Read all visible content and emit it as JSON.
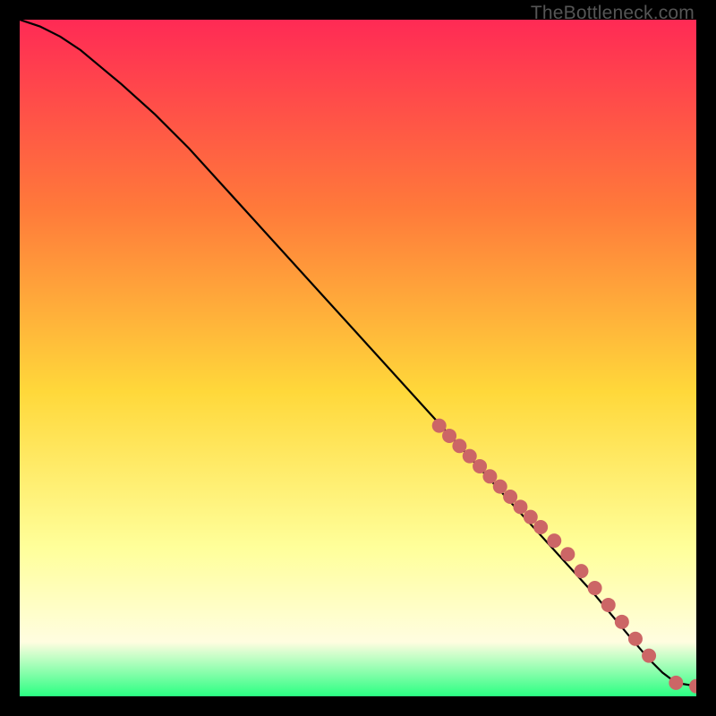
{
  "watermark": "TheBottleneck.com",
  "colors": {
    "gradient_top": "#ff2a55",
    "gradient_upper_mid": "#ff7a3a",
    "gradient_mid": "#ffd83a",
    "gradient_lower_mid": "#ffff9a",
    "gradient_cream": "#fffde0",
    "gradient_bottom": "#2aff82",
    "curve": "#000000",
    "marker": "#cc6666"
  },
  "chart_data": {
    "type": "line",
    "title": "",
    "xlabel": "",
    "ylabel": "",
    "xlim": [
      0,
      100
    ],
    "ylim": [
      0,
      100
    ],
    "series": [
      {
        "name": "bottleneck-curve",
        "x": [
          0,
          3,
          6,
          9,
          12,
          15,
          20,
          25,
          30,
          35,
          40,
          45,
          50,
          55,
          60,
          65,
          70,
          75,
          80,
          85,
          90,
          93,
          95,
          97,
          100
        ],
        "values": [
          100,
          99,
          97.5,
          95.5,
          93,
          90.5,
          86,
          81,
          75.5,
          70,
          64.5,
          59,
          53.5,
          48,
          42.5,
          37,
          31.5,
          26,
          20.5,
          15,
          9,
          5.5,
          3.5,
          2,
          1.5
        ]
      }
    ],
    "markers": {
      "name": "highlighted-points",
      "x": [
        62,
        63.5,
        65,
        66.5,
        68,
        69.5,
        71,
        72.5,
        74,
        75.5,
        77,
        79,
        81,
        83,
        85,
        87,
        89,
        91,
        93,
        97,
        100
      ],
      "values": [
        40,
        38.5,
        37,
        35.5,
        34,
        32.5,
        31,
        29.5,
        28,
        26.5,
        25,
        23,
        21,
        18.5,
        16,
        13.5,
        11,
        8.5,
        6,
        2,
        1.5
      ]
    }
  }
}
